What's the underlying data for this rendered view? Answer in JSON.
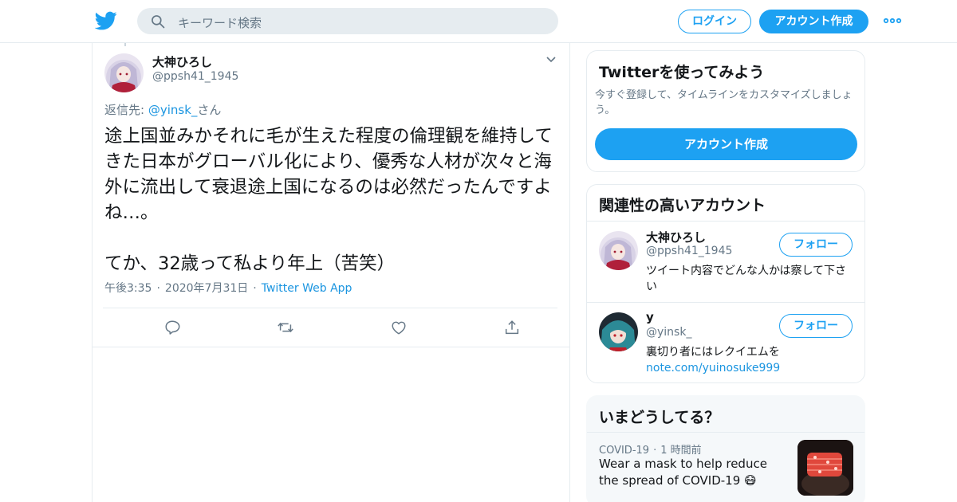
{
  "colors": {
    "accent": "#1da1f2",
    "link": "#1b95e0",
    "text": "#14171a",
    "secondary": "#657786",
    "border": "#e6ecf0"
  },
  "header": {
    "logo_icon": "twitter-bird-icon",
    "search_placeholder": "キーワード検索",
    "login_label": "ログイン",
    "signup_label": "アカウント作成",
    "more_icon": "more-dots-icon"
  },
  "tweet": {
    "author_name": "大神ひろし",
    "author_handle": "@ppsh41_1945",
    "reply_prefix": "返信先: ",
    "reply_mention": "@yinsk_",
    "reply_suffix": "さん",
    "text": "途上国並みかそれに毛が生えた程度の倫理観を維持してきた日本がグローバル化により、優秀な人材が次々と海外に流出して衰退途上国になるのは必然だったんですよね…。\n\nてか、32歳って私より年上（苦笑）",
    "time": "午後3:35",
    "date": "2020年7月31日",
    "source": "Twitter Web App",
    "actions": [
      "reply-icon",
      "retweet-icon",
      "like-icon",
      "share-icon"
    ]
  },
  "sidebar": {
    "signup_card": {
      "title": "Twitterを使ってみよう",
      "description": "今すぐ登録して、タイムラインをカスタマイズしましょう。",
      "button": "アカウント作成"
    },
    "related": {
      "title": "関連性の高いアカウント",
      "follow_label": "フォロー",
      "accounts": [
        {
          "name": "大神ひろし",
          "handle": "@ppsh41_1945",
          "bio": "ツイート内容でどんな人かは察して下さい",
          "bio_link": ""
        },
        {
          "name": "y",
          "handle": "@yinsk_",
          "bio": "裏切り者にはレクイエムを",
          "bio_link": "note.com/yuinosuke999"
        }
      ]
    },
    "trends": {
      "title": "いまどうしてる？",
      "items": [
        {
          "category": "COVID-19",
          "time": "1 時間前",
          "text": "Wear a mask to help reduce the spread of COVID-19 😷"
        }
      ]
    }
  }
}
